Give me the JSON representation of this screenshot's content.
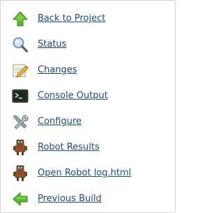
{
  "sidebar": {
    "items": [
      {
        "label": "Back to Project",
        "icon": "up-arrow-icon"
      },
      {
        "label": "Status",
        "icon": "search-magnifier-icon"
      },
      {
        "label": "Changes",
        "icon": "notepad-pencil-icon"
      },
      {
        "label": "Console Output",
        "icon": "terminal-icon"
      },
      {
        "label": "Configure",
        "icon": "wrench-screwdriver-icon"
      },
      {
        "label": "Robot Results",
        "icon": "robot-icon"
      },
      {
        "label": "Open Robot log.html",
        "icon": "robot-icon"
      },
      {
        "label": "Previous Build",
        "icon": "left-arrow-icon"
      }
    ]
  },
  "colors": {
    "link": "#204a87",
    "arrow_green": "#4e9a06",
    "border": "#d6d6d6"
  }
}
